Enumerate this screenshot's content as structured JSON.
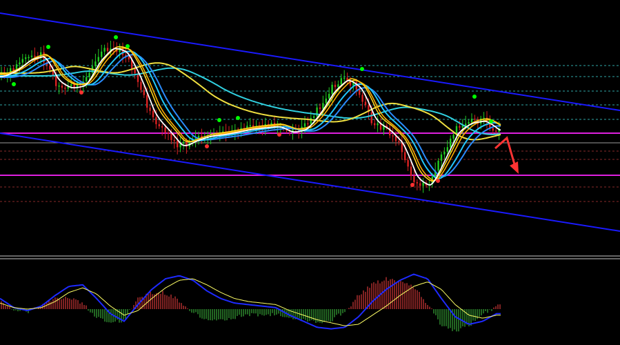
{
  "colors": {
    "background": "#000000",
    "channel": "#1a1aff",
    "support_resistance": "#e020e0",
    "level_dashed": "#2fa7a7",
    "level_red_dashed": "#8a2a2a",
    "level_gray": "#9a9a9a",
    "bull_candle": "#22cc22",
    "bear_candle": "#dd2222",
    "ma_white": "#ffffff",
    "ma_yellow": "#ffd21e",
    "ma_orange": "#ffb000",
    "ma_cyan": "#22c8ff",
    "ma_blue": "#2a8cff",
    "ma_long_cyan": "#30d0e0",
    "ma_long_yellow": "#f0e040",
    "fractal_up": "#00ff00",
    "fractal_down": "#ff3030",
    "arrow": "#ff3333",
    "macd_signal": "#ffff66",
    "macd_line": "#1e2aff",
    "hist_up": "#ff4444",
    "hist_down": "#44cc44"
  },
  "chart_data": [
    {
      "type": "candlestick",
      "panel": "price",
      "x": [
        0,
        20,
        40,
        60,
        80,
        100,
        120,
        140,
        160,
        180,
        200,
        220,
        240,
        260,
        280,
        300,
        320,
        340,
        360,
        380,
        400,
        420,
        440,
        460,
        480,
        500,
        520,
        540,
        560,
        580,
        600,
        620,
        640,
        660,
        680,
        700,
        720
      ],
      "series": [
        {
          "name": "",
          "kind": "close",
          "values": [
            110,
            100,
            84,
            80,
            120,
            128,
            122,
            84,
            66,
            76,
            118,
            170,
            190,
            214,
            202,
            196,
            194,
            190,
            186,
            184,
            182,
            192,
            186,
            160,
            128,
            112,
            130,
            178,
            188,
            210,
            262,
            270,
            226,
            186,
            176,
            174,
            190
          ]
        }
      ],
      "fractals_up": [
        [
          20,
          122
        ],
        [
          70,
          68
        ],
        [
          168,
          54
        ],
        [
          185,
          67
        ],
        [
          318,
          174
        ],
        [
          345,
          171
        ],
        [
          525,
          100
        ],
        [
          688,
          140
        ],
        [
          712,
          176
        ]
      ],
      "fractals_down": [
        [
          118,
          134
        ],
        [
          300,
          212
        ],
        [
          405,
          195
        ],
        [
          635,
          262
        ],
        [
          598,
          268
        ]
      ],
      "channel_lines": [
        {
          "from": [
            0,
            19
          ],
          "to": [
            899,
            160
          ]
        },
        {
          "from": [
            0,
            193
          ],
          "to": [
            899,
            335
          ]
        }
      ],
      "horizontal_levels": [
        {
          "style": "solid",
          "color": "magenta",
          "price": 193
        },
        {
          "style": "solid",
          "color": "magenta",
          "price": 254
        },
        {
          "style": "dashed",
          "color": "teal",
          "price": 95
        },
        {
          "style": "dashed",
          "color": "teal",
          "price": 111
        },
        {
          "style": "dashed",
          "color": "teal",
          "price": 132
        },
        {
          "style": "dashed",
          "color": "teal",
          "price": 152
        },
        {
          "style": "dashed",
          "color": "teal",
          "price": 173
        },
        {
          "style": "solid",
          "color": "gray",
          "price": 207
        },
        {
          "style": "dashed",
          "color": "red",
          "price": 219
        },
        {
          "style": "dashed",
          "color": "red",
          "price": 231
        },
        {
          "style": "dashed",
          "color": "red",
          "price": 271
        },
        {
          "style": "dashed",
          "color": "red",
          "price": 292
        }
      ],
      "arrow": {
        "from": [
          735,
          200
        ],
        "to": [
          752,
          252
        ]
      }
    },
    {
      "type": "macd",
      "panel": "indicator",
      "x": [
        0,
        20,
        40,
        60,
        80,
        100,
        120,
        140,
        160,
        180,
        200,
        220,
        240,
        260,
        280,
        300,
        320,
        340,
        360,
        380,
        400,
        420,
        440,
        460,
        480,
        500,
        520,
        540,
        560,
        580,
        600,
        620,
        640,
        660,
        680,
        700,
        720
      ],
      "series": [
        {
          "name": "",
          "kind": "signal",
          "values": [
            8,
            2,
            0,
            2,
            10,
            22,
            28,
            20,
            4,
            -8,
            -2,
            14,
            28,
            38,
            40,
            32,
            22,
            14,
            10,
            8,
            6,
            -2,
            -8,
            -14,
            -18,
            -22,
            -20,
            -8,
            4,
            18,
            30,
            36,
            26,
            6,
            -8,
            -12,
            -8
          ]
        },
        {
          "name": "",
          "kind": "macd",
          "values": [
            14,
            2,
            -2,
            4,
            18,
            30,
            32,
            14,
            -6,
            -16,
            6,
            26,
            40,
            44,
            38,
            24,
            14,
            8,
            6,
            4,
            2,
            -8,
            -16,
            -24,
            -26,
            -24,
            -10,
            10,
            26,
            38,
            46,
            40,
            14,
            -10,
            -20,
            -16,
            -6
          ]
        },
        {
          "name": "",
          "kind": "histogram",
          "values": [
            6,
            0,
            -2,
            2,
            8,
            8,
            4,
            -6,
            -10,
            -8,
            8,
            12,
            12,
            6,
            -2,
            -8,
            -8,
            -6,
            -4,
            -4,
            -4,
            -6,
            -8,
            -10,
            -8,
            -2,
            10,
            18,
            22,
            20,
            16,
            4,
            -12,
            -16,
            -12,
            -4,
            2
          ]
        }
      ]
    }
  ]
}
